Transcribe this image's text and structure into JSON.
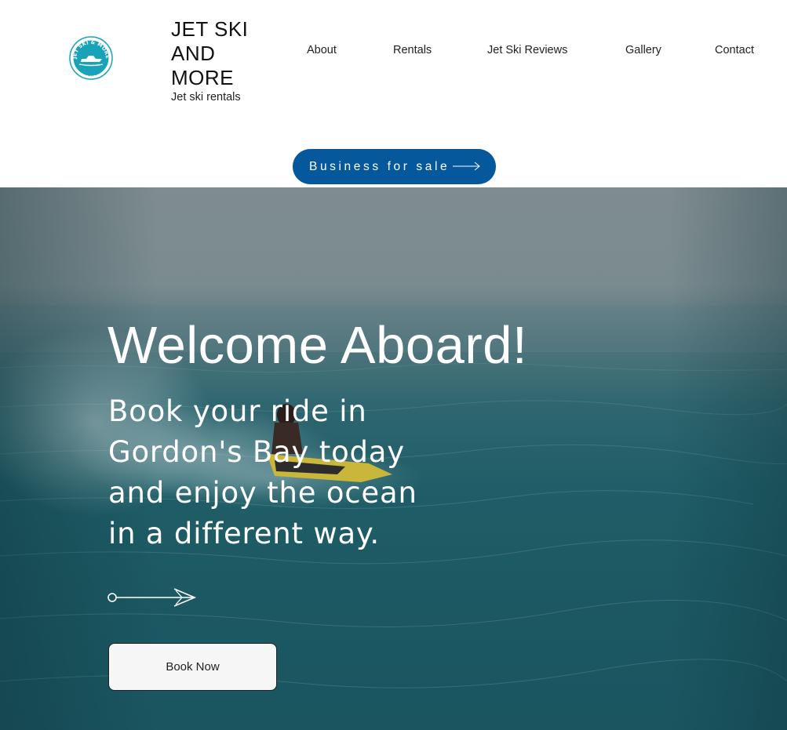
{
  "brand": {
    "logo_text_top": "JET SKI & MORE",
    "logo_text_bottom": "GORDON'S BAY",
    "title": "JET SKI\nAND\nMORE",
    "tagline": "Jet ski rentals"
  },
  "nav": {
    "items": [
      {
        "label": "About"
      },
      {
        "label": "Rentals"
      },
      {
        "label": "Jet Ski Reviews"
      },
      {
        "label": "Gallery"
      },
      {
        "label": "Contact"
      }
    ]
  },
  "banner": {
    "sale_label": "Business for sale"
  },
  "hero": {
    "title": "Welcome Aboard!",
    "subtitle": "Book your ride  in Gordon's Bay today and enjoy the ocean in a different way.",
    "book_label": "Book Now"
  },
  "colors": {
    "accent": "#04589b",
    "logo_teal": "#1aa3b8",
    "ocean": "#1f5e68"
  }
}
